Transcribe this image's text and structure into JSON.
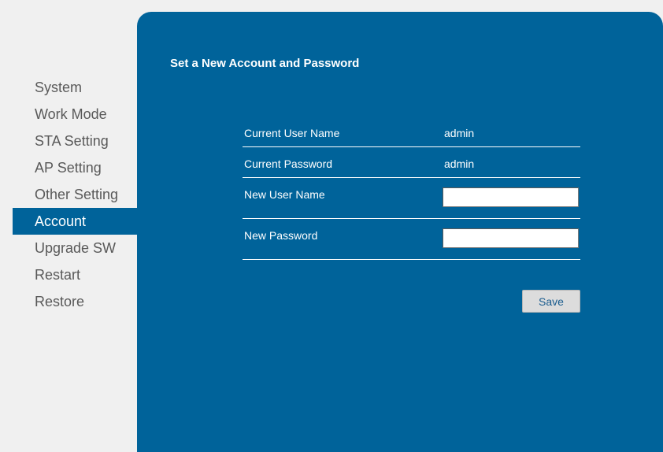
{
  "sidebar": {
    "items": [
      {
        "label": "System"
      },
      {
        "label": "Work Mode"
      },
      {
        "label": "STA Setting"
      },
      {
        "label": "AP Setting"
      },
      {
        "label": "Other Setting"
      },
      {
        "label": "Account",
        "active": true
      },
      {
        "label": "Upgrade SW"
      },
      {
        "label": "Restart"
      },
      {
        "label": "Restore"
      }
    ]
  },
  "panel": {
    "title": "Set a New Account and Password",
    "current_user_name": {
      "label": "Current User Name",
      "value": "admin"
    },
    "current_password": {
      "label": "Current Password",
      "value": "admin"
    },
    "new_user_name": {
      "label": "New User Name",
      "value": ""
    },
    "new_password": {
      "label": "New Password",
      "value": ""
    },
    "save_label": "Save"
  },
  "colors": {
    "accent": "#00639a",
    "background": "#f0f0f0",
    "sidebar_text": "#595959",
    "button_bg": "#dcdcdc",
    "button_text": "#1a5c8e"
  }
}
